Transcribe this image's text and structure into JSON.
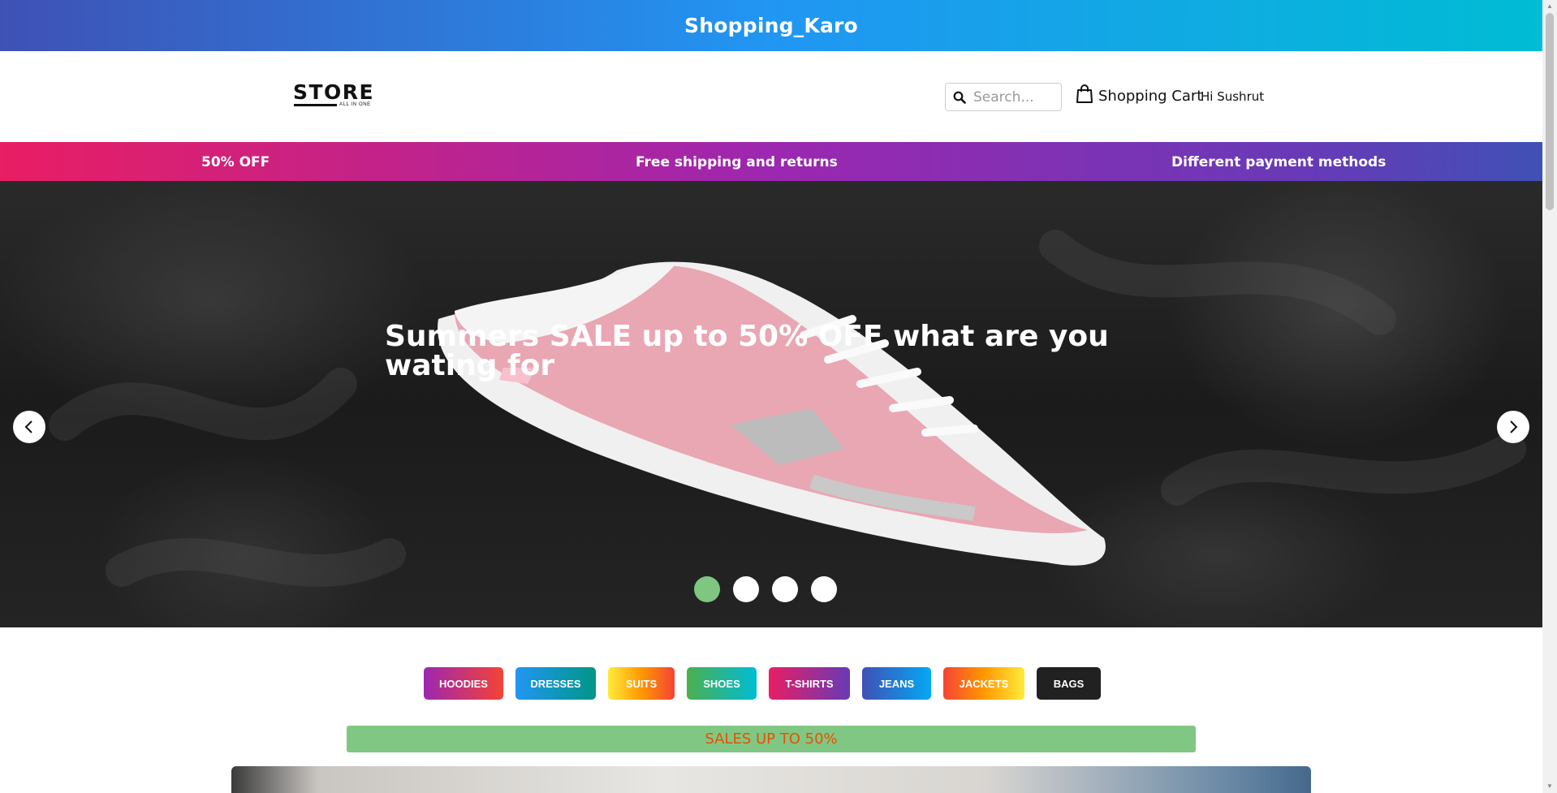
{
  "topbar": {
    "title": "Shopping_Karo"
  },
  "header": {
    "logo_text": "STORE",
    "logo_subtext": "ALL IN ONE",
    "search_placeholder": "Search...",
    "cart_label": "Shopping Cart",
    "greeting": "Hi Sushrut"
  },
  "promo": {
    "items": [
      "50% OFF",
      "Free shipping and returns",
      "Different payment methods"
    ]
  },
  "hero": {
    "caption": "Summers SALE up to 50% OFF what are you wating for",
    "slide_count": 4,
    "active_slide": 1,
    "active_dot_color": "#7fc681"
  },
  "categories": [
    {
      "label": "HOODIES",
      "gradient": "linear-gradient(90deg,#9c27b0,#f44336)"
    },
    {
      "label": "DRESSES",
      "gradient": "linear-gradient(90deg,#2196f3,#009688)"
    },
    {
      "label": "SUITS",
      "gradient": "linear-gradient(90deg,#ffeb3b,#ff9800,#f44336)"
    },
    {
      "label": "SHOES",
      "gradient": "linear-gradient(90deg,#4caf50,#00bcd4)"
    },
    {
      "label": "T-SHIRTS",
      "gradient": "linear-gradient(90deg,#e91e63,#673ab7)"
    },
    {
      "label": "JEANS",
      "gradient": "linear-gradient(90deg,#3f51b5,#03a9f4)"
    },
    {
      "label": "JACKETS",
      "gradient": "linear-gradient(90deg,#f44336,#ff9800,#ffeb3b)"
    },
    {
      "label": "BAGS",
      "gradient": "#212121"
    }
  ],
  "sales_banner": {
    "text": "SALES UP TO 50%"
  }
}
